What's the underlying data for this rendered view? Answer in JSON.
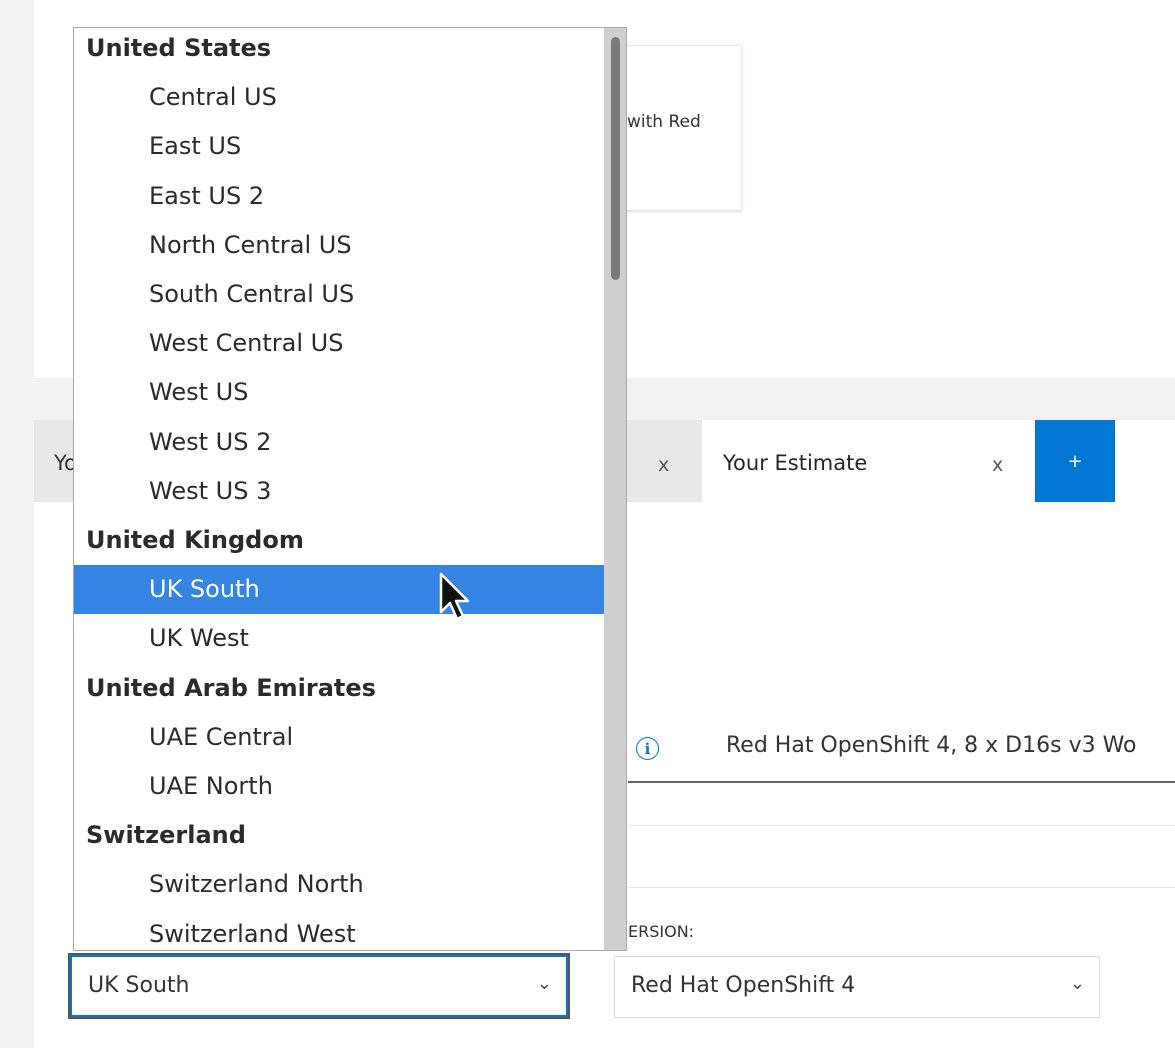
{
  "card": {
    "text": "with Red"
  },
  "tabs": [
    {
      "label": "Yo",
      "close": "x"
    },
    {
      "label": "Your Estimate",
      "close": "x"
    }
  ],
  "add_tab_label": "+",
  "description": {
    "text": "Red Hat OpenShift 4, 8 x D16s v3 Wo"
  },
  "version": {
    "label": "ERSION:",
    "value": "Red Hat OpenShift 4"
  },
  "region": {
    "value": "UK South"
  },
  "chevron": "⌄",
  "dropdown": {
    "options": [
      {
        "type": "group",
        "label": "United States"
      },
      {
        "type": "item",
        "label": "Central US"
      },
      {
        "type": "item",
        "label": "East US"
      },
      {
        "type": "item",
        "label": "East US 2"
      },
      {
        "type": "item",
        "label": "North Central US"
      },
      {
        "type": "item",
        "label": "South Central US"
      },
      {
        "type": "item",
        "label": "West Central US"
      },
      {
        "type": "item",
        "label": "West US"
      },
      {
        "type": "item",
        "label": "West US 2"
      },
      {
        "type": "item",
        "label": "West US 3"
      },
      {
        "type": "group",
        "label": "United Kingdom"
      },
      {
        "type": "item",
        "label": "UK South",
        "selected": true
      },
      {
        "type": "item",
        "label": "UK West"
      },
      {
        "type": "group",
        "label": "United Arab Emirates"
      },
      {
        "type": "item",
        "label": "UAE Central"
      },
      {
        "type": "item",
        "label": "UAE North"
      },
      {
        "type": "group",
        "label": "Switzerland"
      },
      {
        "type": "item",
        "label": "Switzerland North"
      },
      {
        "type": "item",
        "label": "Switzerland West"
      }
    ]
  },
  "colors": {
    "accent": "#0078d4",
    "selected_option": "#3584e4"
  }
}
